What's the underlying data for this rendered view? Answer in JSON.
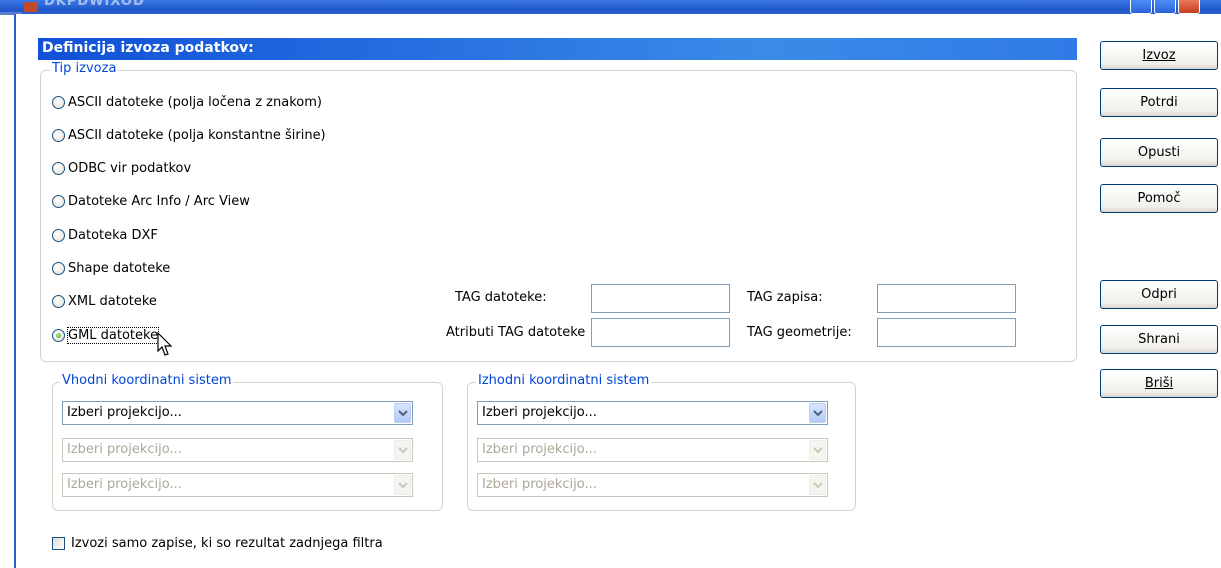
{
  "window": {
    "title": "DKPDWIXOD"
  },
  "header": {
    "title": "Definicija izvoza podatkov:"
  },
  "export_type": {
    "legend": "Tip izvoza",
    "options": [
      {
        "label": "ASCII datoteke (polja ločena z znakom)",
        "checked": false
      },
      {
        "label": "ASCII datoteke (polja konstantne širine)",
        "checked": false
      },
      {
        "label": "ODBC vir podatkov",
        "checked": false
      },
      {
        "label": "Datoteke Arc Info / Arc View",
        "checked": false
      },
      {
        "label": "Datoteka DXF",
        "checked": false
      },
      {
        "label": "Shape datoteke",
        "checked": false
      },
      {
        "label": "XML datoteke",
        "checked": false
      },
      {
        "label": "GML datoteke",
        "checked": true
      }
    ],
    "fields": {
      "tag_file_label": "TAG datoteke:",
      "tag_file_value": "",
      "tag_record_label": "TAG zapisa:",
      "tag_record_value": "",
      "attr_tag_file_label": "Atributi TAG datoteke",
      "attr_tag_file_value": "",
      "tag_geometry_label": "TAG geometrije:",
      "tag_geometry_value": ""
    }
  },
  "input_crs": {
    "legend": "Vhodni koordinatni sistem",
    "combos": [
      {
        "value": "Izberi projekcijo...",
        "enabled": true
      },
      {
        "value": "Izberi projekcijo...",
        "enabled": false
      },
      {
        "value": "Izberi projekcijo...",
        "enabled": false
      }
    ]
  },
  "output_crs": {
    "legend": "Izhodni koordinatni sistem",
    "combos": [
      {
        "value": "Izberi projekcijo...",
        "enabled": true
      },
      {
        "value": "Izberi projekcijo...",
        "enabled": false
      },
      {
        "value": "Izberi projekcijo...",
        "enabled": false
      }
    ]
  },
  "filter_checkbox": {
    "label": "Izvozi samo zapise, ki so rezultat zadnjega filtra",
    "checked": false
  },
  "buttons": {
    "export": "Izvoz",
    "confirm": "Potrdi",
    "cancel": "Opusti",
    "help": "Pomoč",
    "open": "Odpri",
    "save": "Shrani",
    "delete": "Briši"
  },
  "icons": {
    "combo_arrow": "chevron-down-icon",
    "cursor": "mouse-pointer-icon"
  },
  "colors": {
    "header_bg": "#1150d8",
    "legend_text": "#0046d5",
    "titlebar": "#2a61d2"
  }
}
